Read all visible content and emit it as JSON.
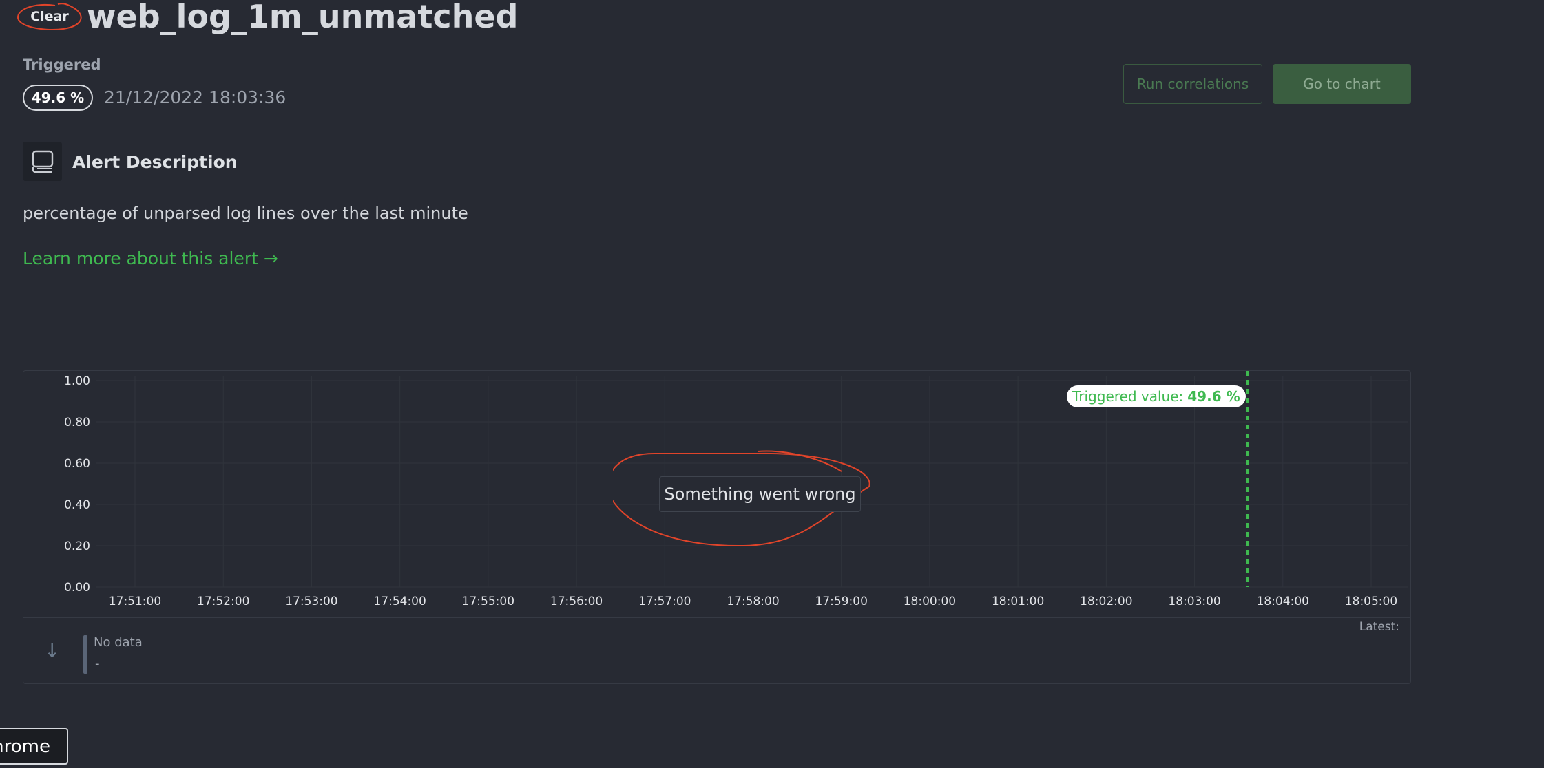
{
  "header": {
    "status_badge": "Clear",
    "title": "web_log_1m_unmatched"
  },
  "triggered": {
    "label": "Triggered",
    "value": "49.6 %",
    "timestamp": "21/12/2022 18:03:36"
  },
  "actions": {
    "run_correlations": "Run correlations",
    "go_to_chart": "Go to chart"
  },
  "description": {
    "icon": "book-icon",
    "heading": "Alert Description",
    "text": "percentage of unparsed log lines over the last minute",
    "learn_more": "Learn more about this alert →"
  },
  "chart": {
    "error_message": "Something went wrong",
    "triggered_label_prefix": "Triggered value:",
    "triggered_label_value": "49.6 %",
    "latest_label": "Latest:",
    "legend": {
      "name": "No data",
      "value": "-"
    },
    "collapse_icon": "arrow-down-icon"
  },
  "chart_data": {
    "type": "line",
    "title": "",
    "xlabel": "",
    "ylabel": "",
    "ylim": [
      0,
      1
    ],
    "y_ticks": [
      "1.00",
      "0.80",
      "0.60",
      "0.40",
      "0.20",
      "0.00"
    ],
    "x_ticks": [
      "17:51:00",
      "17:52:00",
      "17:53:00",
      "17:54:00",
      "17:55:00",
      "17:56:00",
      "17:57:00",
      "17:58:00",
      "17:59:00",
      "18:00:00",
      "18:01:00",
      "18:02:00",
      "18:03:00",
      "18:04:00",
      "18:05:00"
    ],
    "series": [],
    "triggered_marker_time": "18:03:36",
    "grid": true,
    "colors": {
      "marker": "#3fb950",
      "grid": "#30343c",
      "axis_text": "#e2e4e8"
    }
  },
  "taskbar": {
    "tab_label": "hrome"
  },
  "colors": {
    "background": "#272a33",
    "accent_green": "#3fb950",
    "annotation_red": "#e0442a"
  }
}
